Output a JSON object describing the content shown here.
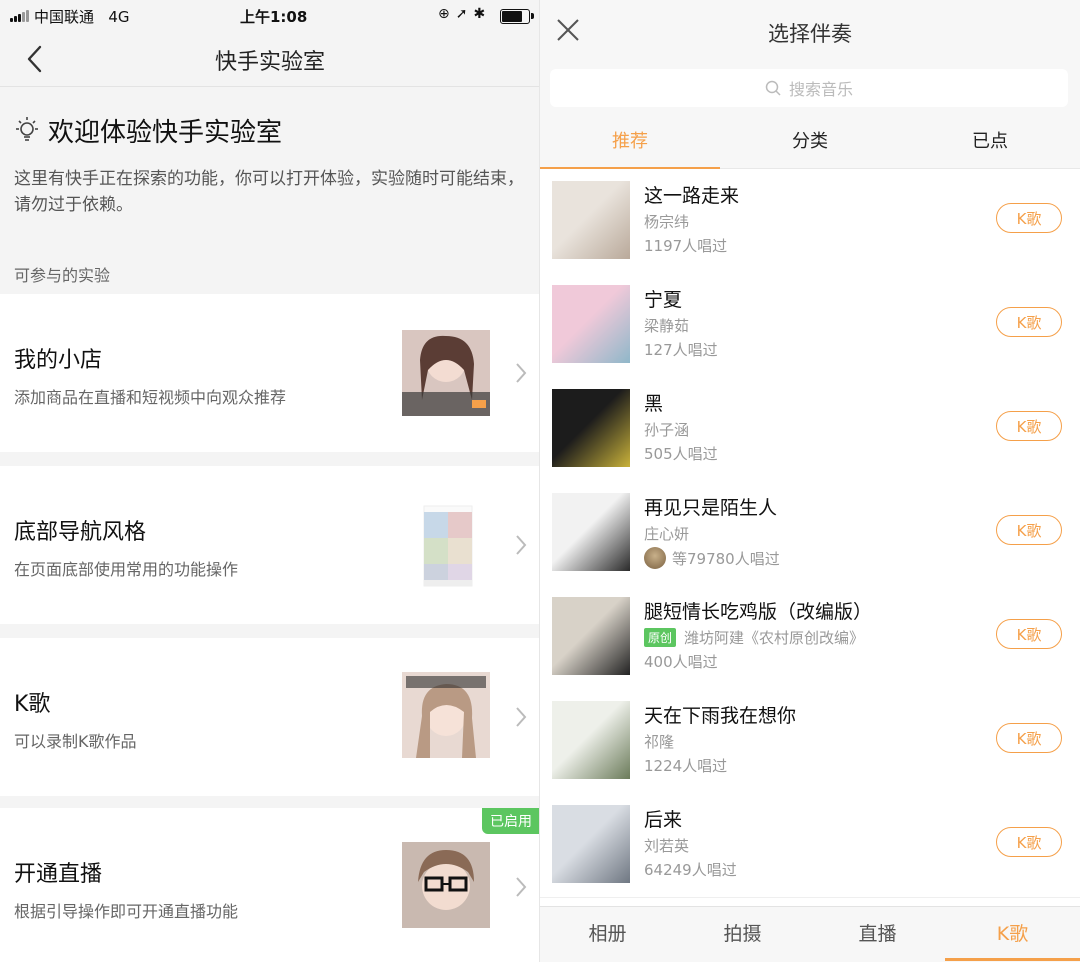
{
  "status_bar": {
    "carrier": "中国联通",
    "network": "4G",
    "time": "上午1:08",
    "battery_level": 0.85
  },
  "left": {
    "nav_title": "快手实验室",
    "welcome_title": "欢迎体验快手实验室",
    "description": "这里有快手正在探索的功能，你可以打开体验，实验随时可能结束，请勿过于依赖。",
    "section_label": "可参与的实验",
    "experiments": [
      {
        "title": "我的小店",
        "desc": "添加商品在直播和短视频中向观众推荐",
        "badge": ""
      },
      {
        "title": "底部导航风格",
        "desc": "在页面底部使用常用的功能操作",
        "badge": ""
      },
      {
        "title": "K歌",
        "desc": "可以录制K歌作品",
        "badge": ""
      },
      {
        "title": "开通直播",
        "desc": "根据引导操作即可开通直播功能",
        "badge": "已启用"
      }
    ]
  },
  "right": {
    "title": "选择伴奏",
    "search_placeholder": "搜索音乐",
    "tabs": [
      {
        "label": "推荐",
        "active": true
      },
      {
        "label": "分类",
        "active": false
      },
      {
        "label": "已点",
        "active": false
      }
    ],
    "k_button_label": "K歌",
    "original_tag": "原创",
    "songs": [
      {
        "title": "这一路走来",
        "artist": "杨宗纬",
        "count": "1197人唱过",
        "colors": [
          "#e9e3dc",
          "#b9a99a"
        ]
      },
      {
        "title": "宁夏",
        "artist": "梁静茹",
        "count": "127人唱过",
        "colors": [
          "#f0c9d9",
          "#8fb7c9"
        ]
      },
      {
        "title": "黑",
        "artist": "孙子涵",
        "count": "505人唱过",
        "colors": [
          "#1c1c1c",
          "#c9b23a"
        ]
      },
      {
        "title": "再见只是陌生人",
        "artist": "庄心妍",
        "count": "等79780人唱过",
        "colors": [
          "#f2f2f2",
          "#2a2a2a"
        ]
      },
      {
        "title": "腿短情长吃鸡版（改编版）",
        "artist": "潍坊阿建《农村原创改编》",
        "count": "400人唱过",
        "colors": [
          "#d8d2c8",
          "#222222"
        ]
      },
      {
        "title": "天在下雨我在想你",
        "artist": "祁隆",
        "count": "1224人唱过",
        "colors": [
          "#eef0ea",
          "#6b7b5a"
        ]
      },
      {
        "title": "后来",
        "artist": "刘若英",
        "count": "64249人唱过",
        "colors": [
          "#d9dde3",
          "#6f7782"
        ]
      }
    ],
    "bottom_nav": [
      {
        "label": "相册",
        "active": false
      },
      {
        "label": "拍摄",
        "active": false
      },
      {
        "label": "直播",
        "active": false
      },
      {
        "label": "K歌",
        "active": true
      }
    ]
  }
}
